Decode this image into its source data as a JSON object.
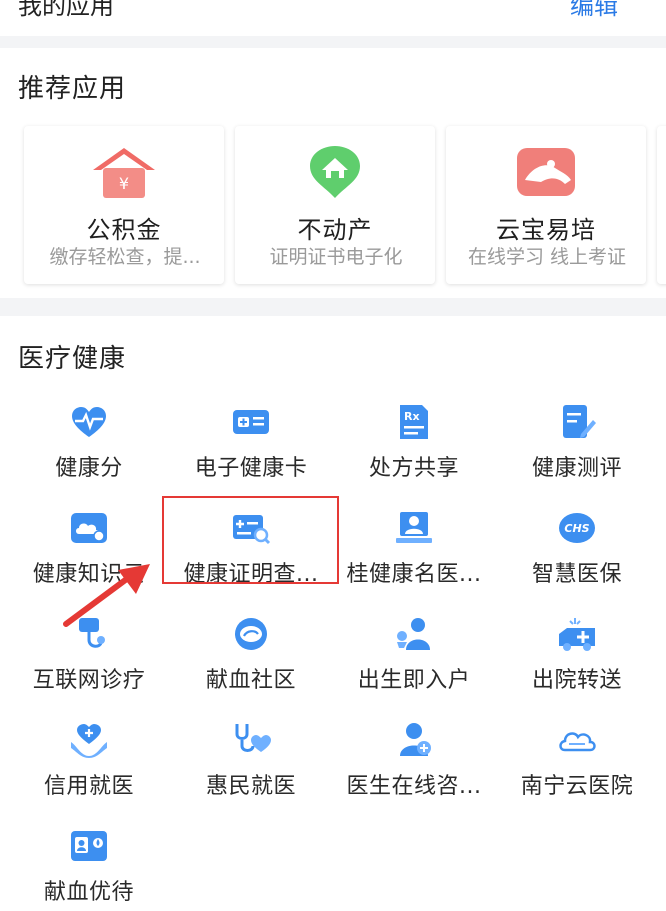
{
  "header": {
    "title": "我的应用",
    "edit_label": "编辑"
  },
  "recommended": {
    "title": "推荐应用",
    "cards": [
      {
        "name": "公积金",
        "desc": "缴存轻松查，提...",
        "icon": "housing-fund-icon"
      },
      {
        "name": "不动产",
        "desc": "证明证书电子化",
        "icon": "real-estate-icon"
      },
      {
        "name": "云宝易培",
        "desc": "在线学习 线上考证",
        "icon": "training-icon"
      }
    ]
  },
  "medical": {
    "title": "医疗健康",
    "items": [
      {
        "label": "健康分",
        "icon": "heartbeat-icon"
      },
      {
        "label": "电子健康卡",
        "icon": "health-card-icon"
      },
      {
        "label": "处方共享",
        "icon": "prescription-icon"
      },
      {
        "label": "健康测评",
        "icon": "assessment-icon"
      },
      {
        "label": "健康知识云",
        "icon": "knowledge-cloud-icon"
      },
      {
        "label": "健康证明查...",
        "icon": "health-certificate-icon"
      },
      {
        "label": "桂健康名医...",
        "icon": "doctor-icon"
      },
      {
        "label": "智慧医保",
        "icon": "medical-insurance-icon"
      },
      {
        "label": "互联网诊疗",
        "icon": "stethoscope-icon"
      },
      {
        "label": "献血社区",
        "icon": "blood-community-icon"
      },
      {
        "label": "出生即入户",
        "icon": "newborn-icon"
      },
      {
        "label": "出院转送",
        "icon": "ambulance-icon"
      },
      {
        "label": "信用就医",
        "icon": "heart-hands-icon"
      },
      {
        "label": "惠民就医",
        "icon": "stethoscope-heart-icon"
      },
      {
        "label": "医生在线咨...",
        "icon": "doctor-online-icon"
      },
      {
        "label": "南宁云医院",
        "icon": "cloud-hospital-icon"
      },
      {
        "label": "献血优待",
        "icon": "donor-card-icon"
      }
    ]
  },
  "colors": {
    "accent": "#2b7be6",
    "icon_blue": "#3d8ff0",
    "highlight": "#e53935"
  }
}
